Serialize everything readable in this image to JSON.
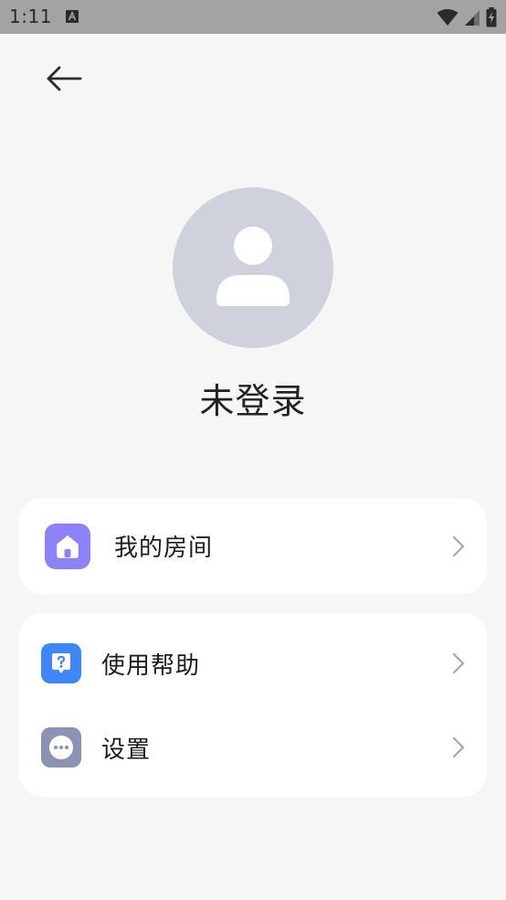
{
  "status_bar": {
    "time": "1:11",
    "battery_charging": true
  },
  "header": {
    "back_icon": "arrow-left-icon"
  },
  "profile": {
    "avatar_icon": "person-icon",
    "name": "未登录",
    "avatar_color": "#cfd1dc"
  },
  "menu": {
    "rooms": {
      "label": "我的房间",
      "icon": "home-icon",
      "icon_color": "#8b83f7"
    },
    "help": {
      "label": "使用帮助",
      "icon": "help-chat-icon",
      "icon_color": "#3f86f6"
    },
    "settings": {
      "label": "设置",
      "icon": "more-dots-icon",
      "icon_color": "#8b92b2"
    },
    "chevron_icon": "chevron-right-icon"
  }
}
